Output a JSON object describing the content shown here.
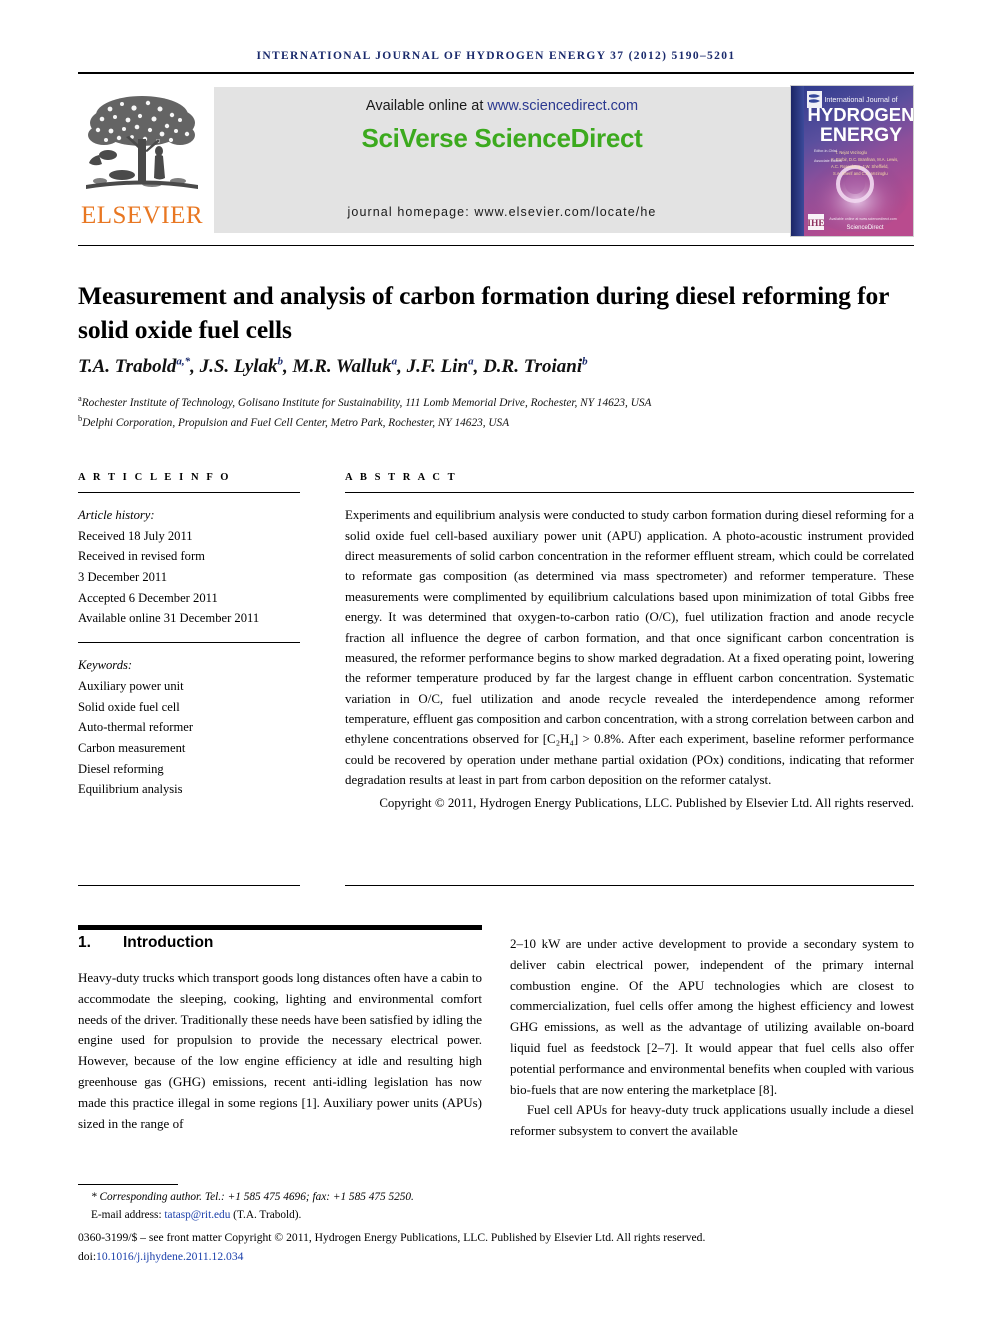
{
  "running_head": "International Journal of Hydrogen Energy 37 (2012) 5190–5201",
  "masthead": {
    "publisher": "ELSEVIER",
    "available_prefix": "Available online at ",
    "available_url": "www.sciencedirect.com",
    "platform_logo": "SciVerse ScienceDirect",
    "homepage": "journal homepage: www.elsevier.com/locate/he",
    "cover": {
      "line1": "International Journal of",
      "line2": "HYDROGEN",
      "line3": "ENERGY",
      "editors_label": "Editor-in-Chief:",
      "editors": "T. Nejat Veziroglu",
      "footer_logo": "ScienceDirect"
    }
  },
  "article": {
    "title": "Measurement and analysis of carbon formation during diesel reforming for solid oxide fuel cells",
    "authors": [
      {
        "name": "T.A. Trabold",
        "sup": "a,*"
      },
      {
        "name": "J.S. Lylak",
        "sup": "b"
      },
      {
        "name": "M.R. Walluk",
        "sup": "a"
      },
      {
        "name": "J.F. Lin",
        "sup": "a"
      },
      {
        "name": "D.R. Troiani",
        "sup": "b"
      }
    ],
    "affiliations": [
      {
        "marker": "a",
        "text": "Rochester Institute of Technology, Golisano Institute for Sustainability, 111 Lomb Memorial Drive, Rochester, NY 14623, USA"
      },
      {
        "marker": "b",
        "text": "Delphi Corporation, Propulsion and Fuel Cell Center, Metro Park, Rochester, NY 14623, USA"
      }
    ]
  },
  "article_info": {
    "heading": "A R T I C L E  I N F O",
    "history_label": "Article history:",
    "history": [
      "Received 18 July 2011",
      "Received in revised form",
      "3 December 2011",
      "Accepted 6 December 2011",
      "Available online 31 December 2011"
    ],
    "keywords_label": "Keywords:",
    "keywords": [
      "Auxiliary power unit",
      "Solid oxide fuel cell",
      "Auto-thermal reformer",
      "Carbon measurement",
      "Diesel reforming",
      "Equilibrium analysis"
    ]
  },
  "abstract": {
    "heading": "A B S T R A C T",
    "body": "Experiments and equilibrium analysis were conducted to study carbon formation during diesel reforming for a solid oxide fuel cell-based auxiliary power unit (APU) application. A photo-acoustic instrument provided direct measurements of solid carbon concentration in the reformer effluent stream, which could be correlated to reformate gas composition (as determined via mass spectrometer) and reformer temperature. These measurements were complimented by equilibrium calculations based upon minimization of total Gibbs free energy. It was determined that oxygen-to-carbon ratio (O/C), fuel utilization fraction and anode recycle fraction all influence the degree of carbon formation, and that once significant carbon concentration is measured, the reformer performance begins to show marked degradation. At a fixed operating point, lowering the reformer temperature produced by far the largest change in effluent carbon concentration. Systematic variation in O/C, fuel utilization and anode recycle revealed the interdependence among reformer temperature, effluent gas composition and carbon concentration, with a strong correlation between carbon and ethylene concentrations observed for [C₂H₄] > 0.8%. After each experiment, baseline reformer performance could be recovered by operation under methane partial oxidation (POx) conditions, indicating that reformer degradation results at least in part from carbon deposition on the reformer catalyst.",
    "copyright": "Copyright © 2011, Hydrogen Energy Publications, LLC. Published by Elsevier Ltd. All rights reserved."
  },
  "body": {
    "section_number": "1.",
    "section_title": "Introduction",
    "left_paragraph": "Heavy-duty trucks which transport goods long distances often have a cabin to accommodate the sleeping, cooking, lighting and environmental comfort needs of the driver. Traditionally these needs have been satisfied by idling the engine used for propulsion to provide the necessary electrical power. However, because of the low engine efficiency at idle and resulting high greenhouse gas (GHG) emissions, recent anti-idling legislation has now made this practice illegal in some regions [1]. Auxiliary power units (APUs) sized in the range of",
    "right_paragraph_1": "2–10 kW are under active development to provide a secondary system to deliver cabin electrical power, independent of the primary internal combustion engine. Of the APU technologies which are closest to commercialization, fuel cells offer among the highest efficiency and lowest GHG emissions, as well as the advantage of utilizing available on-board liquid fuel as feedstock [2–7]. It would appear that fuel cells also offer potential performance and environmental benefits when coupled with various bio-fuels that are now entering the marketplace [8].",
    "right_paragraph_2": "Fuel cell APUs for heavy-duty truck applications usually include a diesel reformer subsystem to convert the available"
  },
  "footer": {
    "corresponding": "* Corresponding author. Tel.: +1 585 475 4696; fax: +1 585 475 5250.",
    "email_label": "E-mail address: ",
    "email": "tatasp@rit.edu",
    "email_suffix": " (T.A. Trabold).",
    "issn_line": "0360-3199/$ – see front matter Copyright © 2011, Hydrogen Energy Publications, LLC. Published by Elsevier Ltd. All rights reserved.",
    "doi_prefix": "doi:",
    "doi": "10.1016/j.ijhydene.2011.12.034"
  },
  "colors": {
    "journal_navy": "#1a2a6c",
    "elsevier_orange": "#e87722",
    "sciencedirect_green": "#3caa1e",
    "link_blue": "#1a3faa",
    "band_gray": "#e3e3e3"
  }
}
